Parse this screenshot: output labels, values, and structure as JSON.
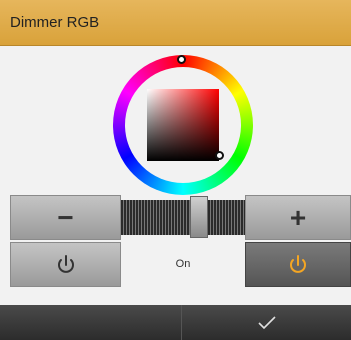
{
  "header": {
    "title": "Dimmer RGB"
  },
  "color_picker": {
    "selected_hue": "red",
    "hue_marker_color": "#ffffff",
    "sv_marker_color": "#ffffff"
  },
  "controls": {
    "minus_label": "−",
    "plus_label": "+",
    "brightness_level": 0.65,
    "state_label": "On",
    "power_off_icon": "power-icon",
    "power_on_icon": "power-icon",
    "power_on_color": "#f5a623",
    "power_off_color": "#333333"
  },
  "footer": {
    "confirm_icon": "checkmark-icon"
  }
}
